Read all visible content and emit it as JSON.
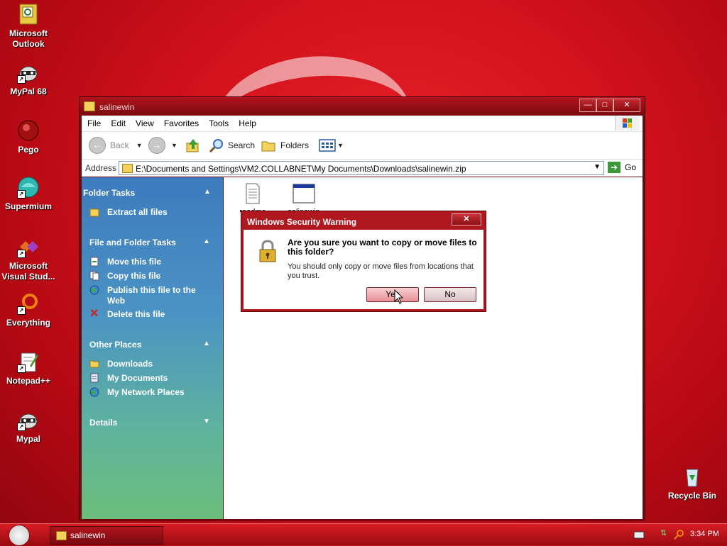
{
  "desktop": {
    "icons": [
      {
        "label_line1": "Microsoft",
        "label_line2": "Outlook"
      },
      {
        "label_line1": "MyPal 68",
        "label_line2": ""
      },
      {
        "label_line1": "Pego",
        "label_line2": ""
      },
      {
        "label_line1": "Supermium",
        "label_line2": ""
      },
      {
        "label_line1": "Microsoft",
        "label_line2": "Visual Stud..."
      },
      {
        "label_line1": "Everything",
        "label_line2": ""
      },
      {
        "label_line1": "Notepad++",
        "label_line2": ""
      },
      {
        "label_line1": "Mypal",
        "label_line2": ""
      },
      {
        "label_line1": "Recycle Bin",
        "label_line2": ""
      }
    ]
  },
  "window": {
    "title": "salinewin",
    "controls": {
      "minimize": "—",
      "maximize": "□",
      "close": "✕"
    },
    "menu": [
      "File",
      "Edit",
      "View",
      "Favorites",
      "Tools",
      "Help"
    ],
    "toolbar": {
      "back": "Back",
      "search": "Search",
      "folders": "Folders"
    },
    "address": {
      "label": "Address",
      "value": "E:\\Documents and Settings\\VM2.COLLABNET\\My Documents\\Downloads\\salinewin.zip",
      "go": "Go"
    }
  },
  "leftpane": {
    "folder_tasks": {
      "title": "Folder Tasks",
      "items": [
        "Extract all files"
      ]
    },
    "file_tasks": {
      "title": "File and Folder Tasks",
      "items": [
        "Move this file",
        "Copy this file",
        "Publish this file to the",
        "Web",
        "Delete this file"
      ]
    },
    "other_places": {
      "title": "Other Places",
      "items": [
        "Downloads",
        "My Documents",
        "My Network Places"
      ]
    },
    "details": {
      "title": "Details"
    }
  },
  "content": {
    "files": [
      {
        "name": "readme",
        "icon": "text-file-icon"
      },
      {
        "name": "salinewin",
        "icon": "program-window-icon"
      }
    ]
  },
  "dialog": {
    "title": "Windows Security Warning",
    "close": "✕",
    "question": "Are you sure you want to copy or move files to this folder?",
    "info": "You should only copy or move files from locations that you trust.",
    "yes": "Yes",
    "no": "No"
  },
  "taskbar": {
    "task_label": "salinewin",
    "clock": "3:34 PM"
  },
  "colors": {
    "accent": "#d3121c",
    "pane_blue": "#3d7bbd",
    "pane_green": "#6cbd7a"
  }
}
